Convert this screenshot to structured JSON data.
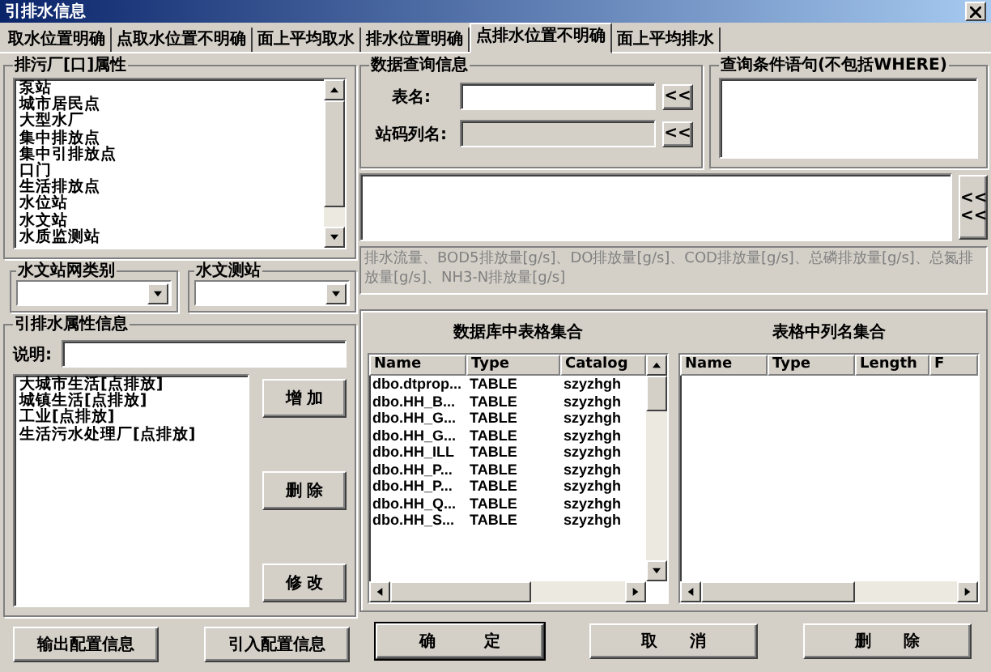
{
  "window": {
    "title": "引排水信息"
  },
  "tabs": [
    {
      "label": "取水位置明确",
      "selected": false
    },
    {
      "label": "点取水位置不明确",
      "selected": false
    },
    {
      "label": "面上平均取水",
      "selected": false
    },
    {
      "label": "排水位置明确",
      "selected": false
    },
    {
      "label": "点排水位置不明确",
      "selected": true
    },
    {
      "label": "面上平均排水",
      "selected": false
    }
  ],
  "outlet_group": {
    "title": "排污厂[口]属性",
    "items": [
      "泵站",
      "城市居民点",
      "大型水厂",
      "集中排放点",
      "集中引排放点",
      "口门",
      "生活排放点",
      "水位站",
      "水文站",
      "水质监测站"
    ]
  },
  "station_network_type": {
    "label": "水文站网类别"
  },
  "hydro_station": {
    "label": "水文测站"
  },
  "attribute_group": {
    "title": "引排水属性信息",
    "note_label": "说明:",
    "items": [
      "大城市生活[点排放]",
      "城镇生活[点排放]",
      "工业[点排放]",
      "生活污水处理厂[点排放]"
    ],
    "buttons": [
      "增 加",
      "删 除",
      "修 改"
    ]
  },
  "left_buttons": [
    "输出配置信息",
    "引入配置信息"
  ],
  "query_group": {
    "title": "数据查询信息",
    "table_name_label": "表名:",
    "table_name_button": "<<",
    "station_code_label": "站码列名:",
    "station_code_disabled": true,
    "station_code_button": "<<",
    "columns_button": [
      "<<",
      "<<"
    ]
  },
  "condition_group": {
    "title": "查询条件语句(不包括WHERE)"
  },
  "fields_text": "排水流量、BOD5排放量[g/s]、DO排放量[g/s]、COD排放量[g/s]、总磷排放量[g/s]、总氮排放量[g/s]、NH3-N排放量[g/s]",
  "tables_panel": {
    "title": "数据库中表格集合",
    "columns": [
      "Name",
      "Type",
      "Catalog"
    ],
    "rows": [
      [
        "dbo.dtprop...",
        "TABLE",
        "szyzhgh"
      ],
      [
        "dbo.HH_B...",
        "TABLE",
        "szyzhgh"
      ],
      [
        "dbo.HH_G...",
        "TABLE",
        "szyzhgh"
      ],
      [
        "dbo.HH_G...",
        "TABLE",
        "szyzhgh"
      ],
      [
        "dbo.HH_ILL",
        "TABLE",
        "szyzhgh"
      ],
      [
        "dbo.HH_P...",
        "TABLE",
        "szyzhgh"
      ],
      [
        "dbo.HH_P...",
        "TABLE",
        "szyzhgh"
      ],
      [
        "dbo.HH_Q...",
        "TABLE",
        "szyzhgh"
      ],
      [
        "dbo.HH_S...",
        "TABLE",
        "szyzhgh"
      ]
    ]
  },
  "columns_panel": {
    "title": "表格中列名集合",
    "columns": [
      "Name",
      "Type",
      "Length",
      "F"
    ]
  },
  "buttons": [
    "确　　　定",
    "取　　消",
    "删　　除"
  ]
}
